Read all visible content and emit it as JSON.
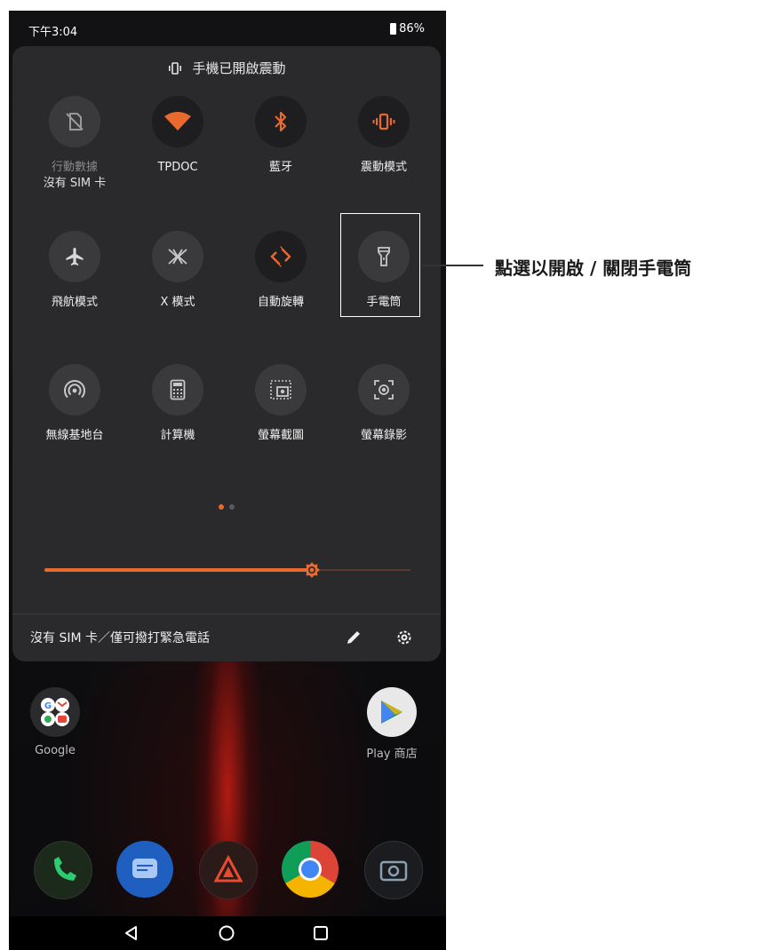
{
  "status_bar": {
    "time": "下午3:04",
    "battery": "86%"
  },
  "vibration_banner": {
    "label": "手機已開啟震動",
    "icon": "vibrate-icon"
  },
  "tiles": [
    {
      "label": "行動數據",
      "sublabel": "沒有 SIM 卡",
      "icon": "no-sim-icon",
      "state": "disabled"
    },
    {
      "label": "TPDOC",
      "icon": "wifi-icon",
      "state": "on"
    },
    {
      "label": "藍牙",
      "icon": "bluetooth-icon",
      "state": "on"
    },
    {
      "label": "震動模式",
      "icon": "vibrate-icon",
      "state": "on"
    },
    {
      "label": "飛航模式",
      "icon": "airplane-icon",
      "state": "off"
    },
    {
      "label": "X 模式",
      "icon": "x-mode-icon",
      "state": "off"
    },
    {
      "label": "自動旋轉",
      "icon": "auto-rotate-icon",
      "state": "on"
    },
    {
      "label": "手電筒",
      "icon": "flashlight-icon",
      "state": "off"
    },
    {
      "label": "無線基地台",
      "icon": "hotspot-icon",
      "state": "off"
    },
    {
      "label": "計算機",
      "icon": "calculator-icon",
      "state": "off"
    },
    {
      "label": "螢幕截圖",
      "icon": "screenshot-icon",
      "state": "off"
    },
    {
      "label": "螢幕錄影",
      "icon": "screen-record-icon",
      "state": "off"
    }
  ],
  "page_indicator": {
    "pages": 2,
    "current": 1
  },
  "brightness": {
    "level": 0.73
  },
  "footer": {
    "status_text": "沒有 SIM 卡／僅可撥打緊急電話",
    "edit_icon": "pencil-icon",
    "settings_icon": "gear-icon"
  },
  "home_apps": [
    {
      "label": "Google",
      "icon": "google-folder-icon"
    },
    {
      "label": "Play 商店",
      "icon": "play-store-icon"
    }
  ],
  "dock": [
    "phone-icon",
    "messages-icon",
    "armoury-icon",
    "chrome-icon",
    "camera-icon"
  ],
  "callout": {
    "text": "點選以開啟 / 關閉手電筒"
  },
  "colors": {
    "accent": "#e86a2e",
    "panel": "#2a2a2c",
    "tile": "#3a3a3c"
  }
}
